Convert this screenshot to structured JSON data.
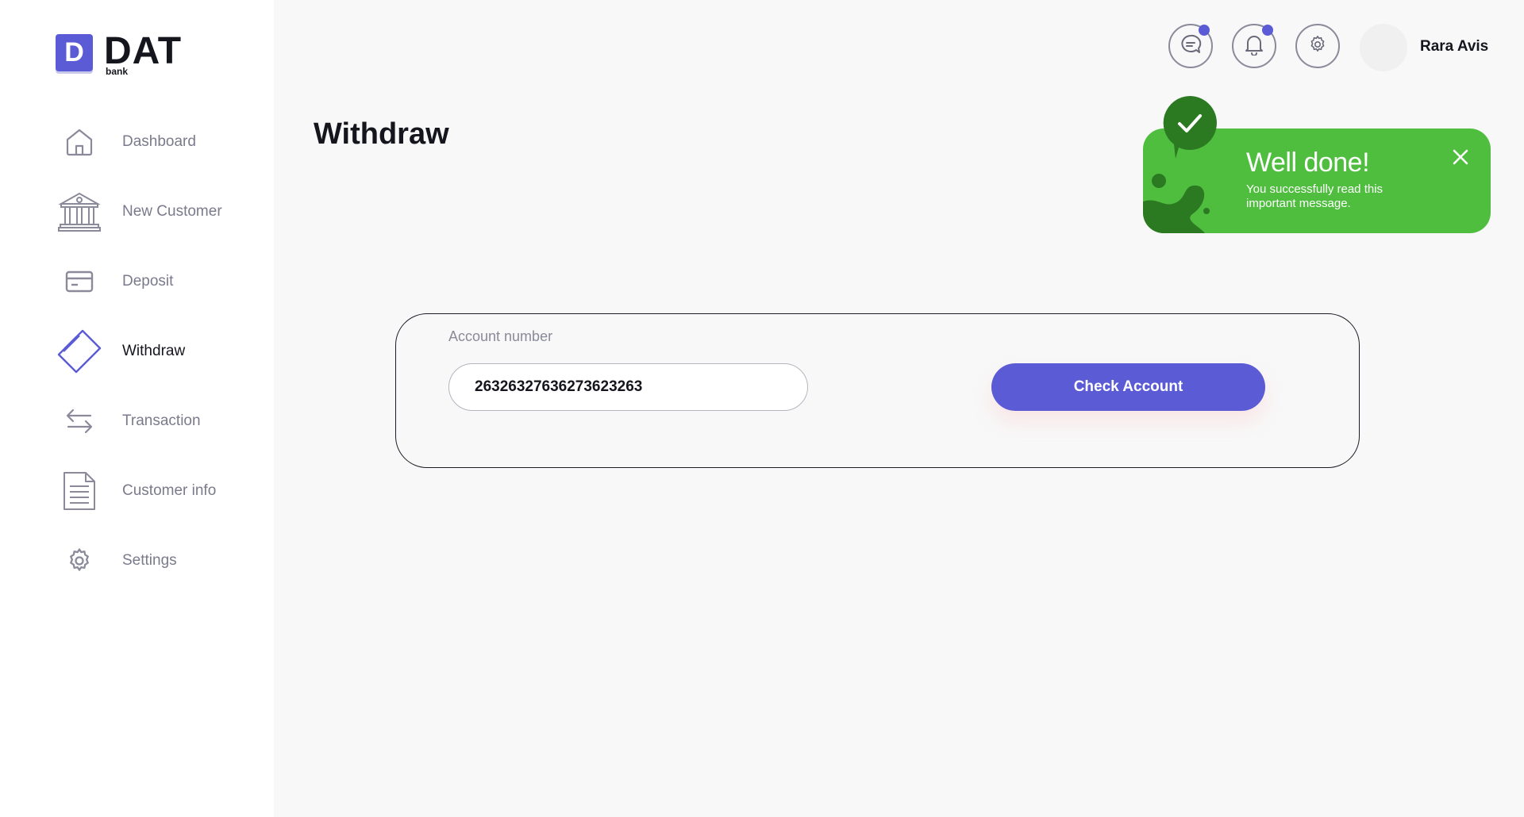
{
  "brand": {
    "badge": "D",
    "name": "DAT",
    "sub": "bank",
    "accent": "#5b5bd6"
  },
  "sidebar": {
    "items": [
      {
        "label": "Dashboard",
        "icon": "home-icon"
      },
      {
        "label": "New Customer",
        "icon": "bank-icon"
      },
      {
        "label": "Deposit",
        "icon": "card-icon"
      },
      {
        "label": "Withdraw",
        "icon": "withdraw-card-icon",
        "active": true
      },
      {
        "label": "Transaction",
        "icon": "transfer-arrows-icon"
      },
      {
        "label": "Customer info",
        "icon": "document-icon"
      },
      {
        "label": "Settings",
        "icon": "gear-icon"
      }
    ]
  },
  "header": {
    "icons": [
      "chat-icon",
      "bell-icon",
      "gear-icon"
    ],
    "user_name": "Rara Avis"
  },
  "page": {
    "title": "Withdraw"
  },
  "toast": {
    "title": "Well done!",
    "message": "You successfully read this important message.",
    "color": "#4fbe3f"
  },
  "form": {
    "account_label": "Account number",
    "account_value": "26326327636273623263",
    "button_label": "Check Account"
  }
}
